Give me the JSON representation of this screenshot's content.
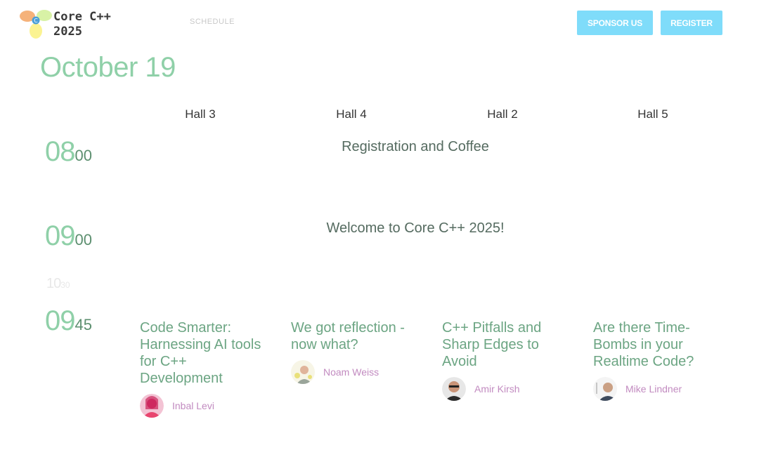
{
  "header": {
    "logo_line1": "Core C++",
    "logo_line2": "2025",
    "nav": [
      "SCHEDULE"
    ],
    "sponsor_label": "SPONSOR US",
    "register_label": "REGISTER"
  },
  "day": {
    "title": "October 19"
  },
  "halls": [
    "Hall 3",
    "Hall 4",
    "Hall 2",
    "Hall 5"
  ],
  "times": [
    {
      "h": "08",
      "m": "00"
    },
    {
      "h": "09",
      "m": "00"
    },
    {
      "h": "10",
      "m": "30"
    },
    {
      "h": "09",
      "m": "45"
    }
  ],
  "plenary": [
    {
      "title": "Registration and Coffee"
    },
    {
      "title": "Welcome to Core C++ 2025!"
    }
  ],
  "talks": [
    {
      "title": "Code Smarter: Harnessing AI tools for C++ Development",
      "speaker": "Inbal Levi"
    },
    {
      "title": "We got reflection - now what?",
      "speaker": "Noam Weiss"
    },
    {
      "title": "C++ Pitfalls and Sharp Edges to Avoid",
      "speaker": "Amir Kirsh"
    },
    {
      "title": "Are there Time-Bombs in your Realtime Code?",
      "speaker": "Mike Lindner"
    }
  ],
  "colors": {
    "accent_button": "#7fdcfa",
    "time_green": "#8fd0a8",
    "talk_title": "#6ca583",
    "speaker_name": "#c28bc0"
  }
}
